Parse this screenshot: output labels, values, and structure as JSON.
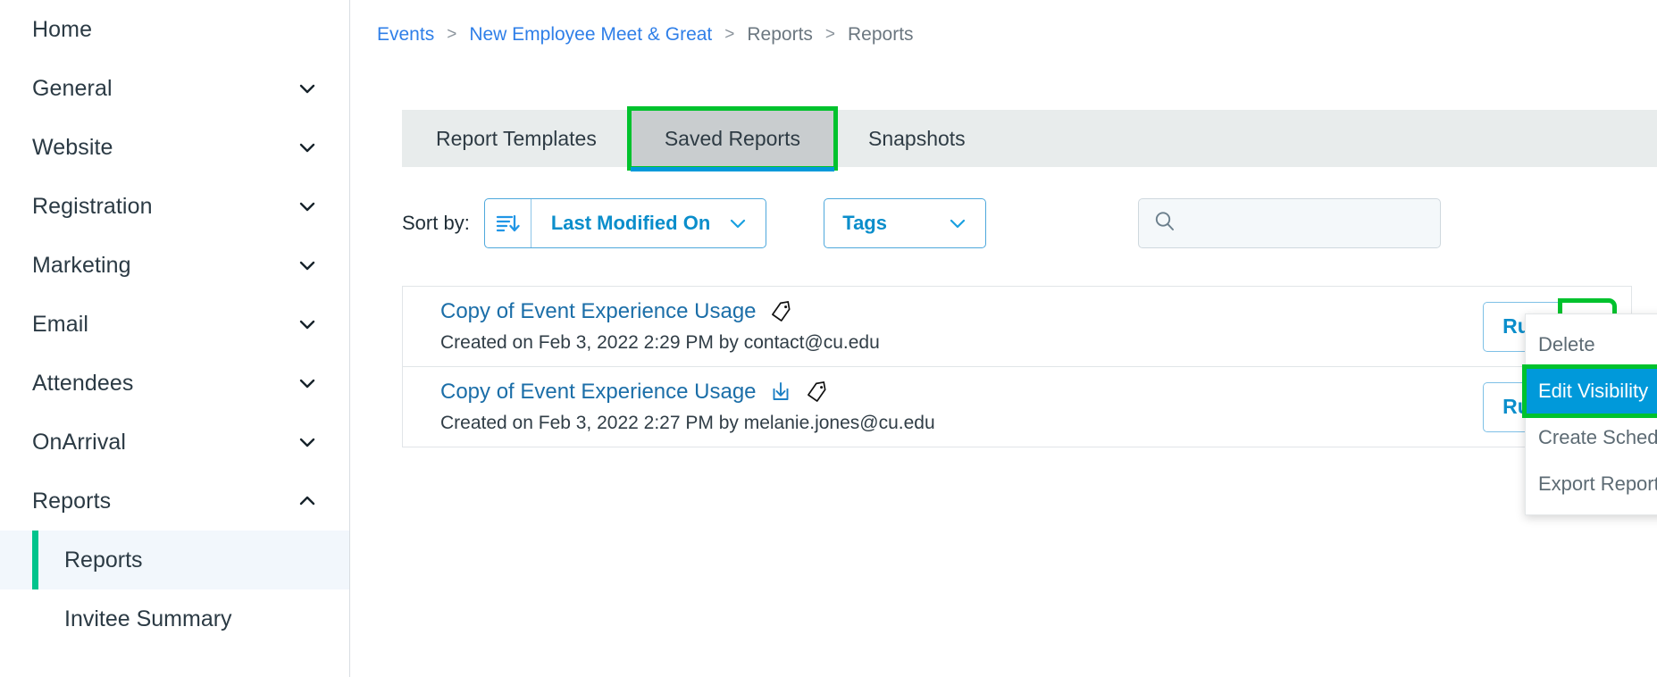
{
  "sidebar": {
    "items": [
      {
        "label": "Home",
        "expandable": false
      },
      {
        "label": "General",
        "expandable": true,
        "icon": "chevron-down-icon"
      },
      {
        "label": "Website",
        "expandable": true,
        "icon": "chevron-down-icon"
      },
      {
        "label": "Registration",
        "expandable": true,
        "icon": "chevron-down-icon"
      },
      {
        "label": "Marketing",
        "expandable": true,
        "icon": "chevron-down-icon"
      },
      {
        "label": "Email",
        "expandable": true,
        "icon": "chevron-down-icon"
      },
      {
        "label": "Attendees",
        "expandable": true,
        "icon": "chevron-down-icon"
      },
      {
        "label": "OnArrival",
        "expandable": true,
        "icon": "chevron-down-icon"
      },
      {
        "label": "Reports",
        "expandable": true,
        "icon": "chevron-up-icon"
      }
    ],
    "sub_items": [
      {
        "label": "Reports",
        "active": true
      },
      {
        "label": "Invitee Summary",
        "active": false
      }
    ],
    "active_accent_color": "#00c48c",
    "active_bg_color": "#f2f7fc"
  },
  "breadcrumb": {
    "separator": ">",
    "items": [
      {
        "label": "Events",
        "link": true
      },
      {
        "label": "New Employee Meet & Great",
        "link": true
      },
      {
        "label": "Reports",
        "link": false
      },
      {
        "label": "Reports",
        "link": false
      }
    ]
  },
  "tabs": {
    "items": [
      {
        "label": "Report Templates",
        "active": false,
        "highlighted": false
      },
      {
        "label": "Saved Reports",
        "active": true,
        "highlighted": true
      },
      {
        "label": "Snapshots",
        "active": false,
        "highlighted": false
      }
    ],
    "active_underline_color": "#0099da",
    "highlight_color": "#00c22d"
  },
  "toolbar": {
    "sort_label": "Sort by:",
    "sort_icon": "sort-descending-icon",
    "sort_value": "Last Modified On",
    "sort_chevron": "chevron-down-icon",
    "tags_label": "Tags",
    "tags_chevron": "chevron-down-icon",
    "search_icon": "search-icon",
    "search_value": "",
    "search_placeholder": ""
  },
  "reports": [
    {
      "title": "Copy of Event Experience Usage",
      "subtitle": "Created on Feb 3, 2022 2:29 PM by contact@cu.edu",
      "icons": [
        "tag-icon"
      ],
      "run_label": "Run",
      "run_chevron": "chevron-down-icon",
      "dropdown_open": true,
      "dropdown_highlighted": true
    },
    {
      "title": "Copy of Event Experience Usage",
      "subtitle": "Created on Feb 3, 2022 2:27 PM by melanie.jones@cu.edu",
      "icons": [
        "download-icon",
        "tag-icon"
      ],
      "run_label": "Run",
      "run_chevron": "chevron-down-icon",
      "dropdown_open": false,
      "dropdown_highlighted": false
    }
  ],
  "context_menu": {
    "items": [
      {
        "label": "Delete",
        "selected": false,
        "highlighted": false
      },
      {
        "label": "Edit Visibility",
        "selected": true,
        "highlighted": true
      },
      {
        "label": "Create Schedule",
        "selected": false,
        "highlighted": false
      },
      {
        "label": "Export Report",
        "selected": false,
        "highlighted": false
      }
    ],
    "selected_bg_color": "#0099da",
    "highlight_color": "#00c22d"
  }
}
